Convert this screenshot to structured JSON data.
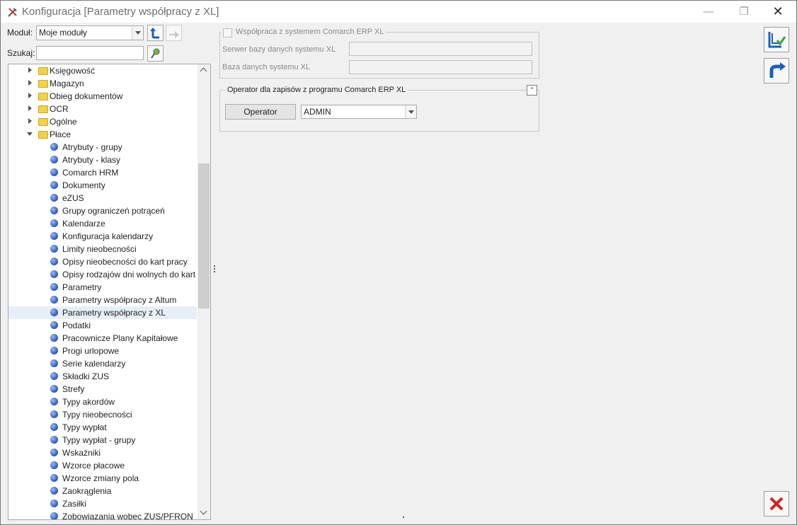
{
  "window": {
    "title": "Konfiguracja [Parametry współpracy z XL]",
    "controls": {
      "minimize": "—",
      "maximize": "❐",
      "close": "✕"
    }
  },
  "module": {
    "label": "Moduł:",
    "value": "Moje moduły"
  },
  "search": {
    "label": "Szukaj:",
    "value": ""
  },
  "tree": {
    "folders": [
      {
        "label": "Księgowość",
        "expanded": false
      },
      {
        "label": "Magazyn",
        "expanded": false
      },
      {
        "label": "Obieg dokumentów",
        "expanded": false
      },
      {
        "label": "OCR",
        "expanded": false
      },
      {
        "label": "Ogólne",
        "expanded": false
      },
      {
        "label": "Płace",
        "expanded": true
      }
    ],
    "children": [
      "Atrybuty - grupy",
      "Atrybuty - klasy",
      "Comarch HRM",
      "Dokumenty",
      "eZUS",
      "Grupy ograniczeń potrąceń",
      "Kalendarze",
      "Konfiguracja kalendarzy",
      "Limity nieobecności",
      "Opisy nieobecności do kart pracy",
      "Opisy rodzajów dni wolnych do kart ...",
      "Parametry",
      "Parametry współpracy z Altum",
      "Parametry współpracy z XL",
      "Podatki",
      "Pracownicze Plany Kapitałowe",
      "Progi urlopowe",
      "Serie kalendarzy",
      "Składki ZUS",
      "Strefy",
      "Typy akordów",
      "Typy nieobecności",
      "Typy wypłat",
      "Typy wypłat - grupy",
      "Wskaźniki",
      "Wzorce płacowe",
      "Wzorce zmiany pola",
      "Zaokrąglenia",
      "Zasiłki",
      "Zobowiązania wobec ZUS/PFRON"
    ],
    "selected": "Parametry współpracy z XL"
  },
  "erp": {
    "legend": "Współpraca z systemem Comarch ERP XL",
    "checked": false,
    "server_label": "Serwer bazy danych systemu XL",
    "server_value": "",
    "db_label": "Baza danych systemu XL",
    "db_value": ""
  },
  "operator": {
    "legend": "Operator dla zapisów z programu Comarch ERP XL",
    "button": "Operator",
    "value": "ADMIN"
  },
  "colors": {
    "accent": "#1e5fb4",
    "cancel": "#d42020",
    "save_check": "#3aa33a"
  }
}
